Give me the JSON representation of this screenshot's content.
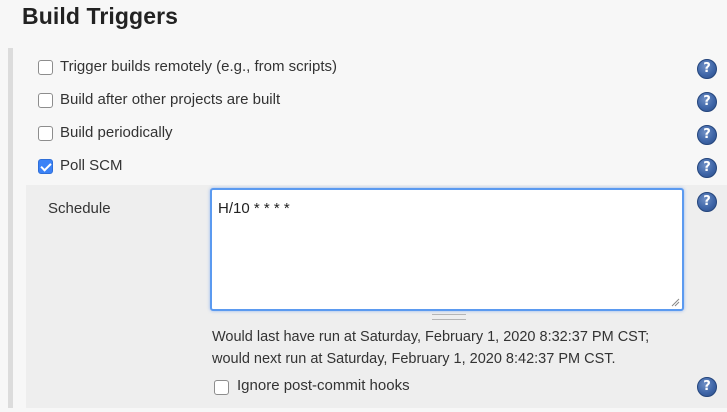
{
  "section": {
    "title": "Build Triggers"
  },
  "triggers": [
    {
      "label": "Trigger builds remotely (e.g., from scripts)",
      "checked": false
    },
    {
      "label": "Build after other projects are built",
      "checked": false
    },
    {
      "label": "Build periodically",
      "checked": false
    },
    {
      "label": "Poll SCM",
      "checked": true
    }
  ],
  "poll_scm": {
    "schedule_label": "Schedule",
    "schedule_value": "H/10 * * * *",
    "info_line1": "Would last have run at Saturday, February 1, 2020 8:32:37 PM CST;",
    "info_line2": "would next run at Saturday, February 1, 2020 8:42:37 PM CST.",
    "ignore_hooks_label": "Ignore post-commit hooks",
    "ignore_hooks_checked": false
  },
  "help_icon_glyph": "?",
  "colors": {
    "accent": "#3b82f6",
    "help_icon": "#3f66a8"
  }
}
